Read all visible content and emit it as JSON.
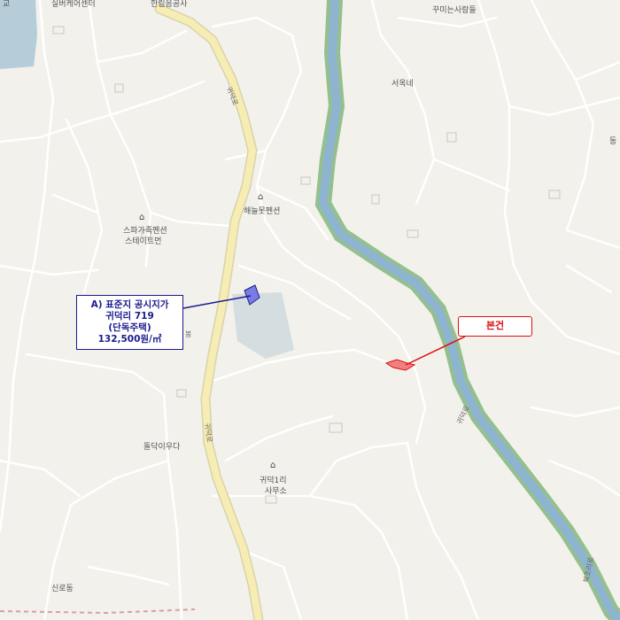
{
  "map": {
    "place_labels": {
      "top_center": "한림음공사",
      "top_left_center": "실버케어센터",
      "top_left_edge": "교",
      "top_right": "꾸미는사람들",
      "seouk": "서옥네",
      "right_edge": "동",
      "haeneul": "해늘못펜션",
      "spa_line1": "스파가족펜션",
      "spa_line2": "스테이트먼",
      "road_west_mid": "봉",
      "dolmu": "돌닥이우다",
      "office_line1": "귀덕1리",
      "office_line2": "사무소",
      "bottom_left": "신로동"
    },
    "road_labels": {
      "main_road_upper": "귀덕로",
      "main_road_lower": "귀덕로",
      "river_road_mid": "귀덕로",
      "river_road_low": "복조리로"
    },
    "standard_land_box": {
      "line1": "A) 표준지 공시지가",
      "line2": "귀덕리 719",
      "line3": "(단독주택)",
      "line4": "132,500원/㎡"
    },
    "subject_box": {
      "label": "본건"
    },
    "colors": {
      "background": "#f2f1ec",
      "road_minor": "#ffffff",
      "road_main": "#f6edb5",
      "river": "#8fb4cf",
      "river_bank": "#94c08d",
      "standard_parcel": "#7b7be6",
      "subject_parcel": "#f08080",
      "leader_blue": "#1b1b8f",
      "leader_red": "#d11"
    },
    "icons": [
      "building-icon"
    ]
  }
}
